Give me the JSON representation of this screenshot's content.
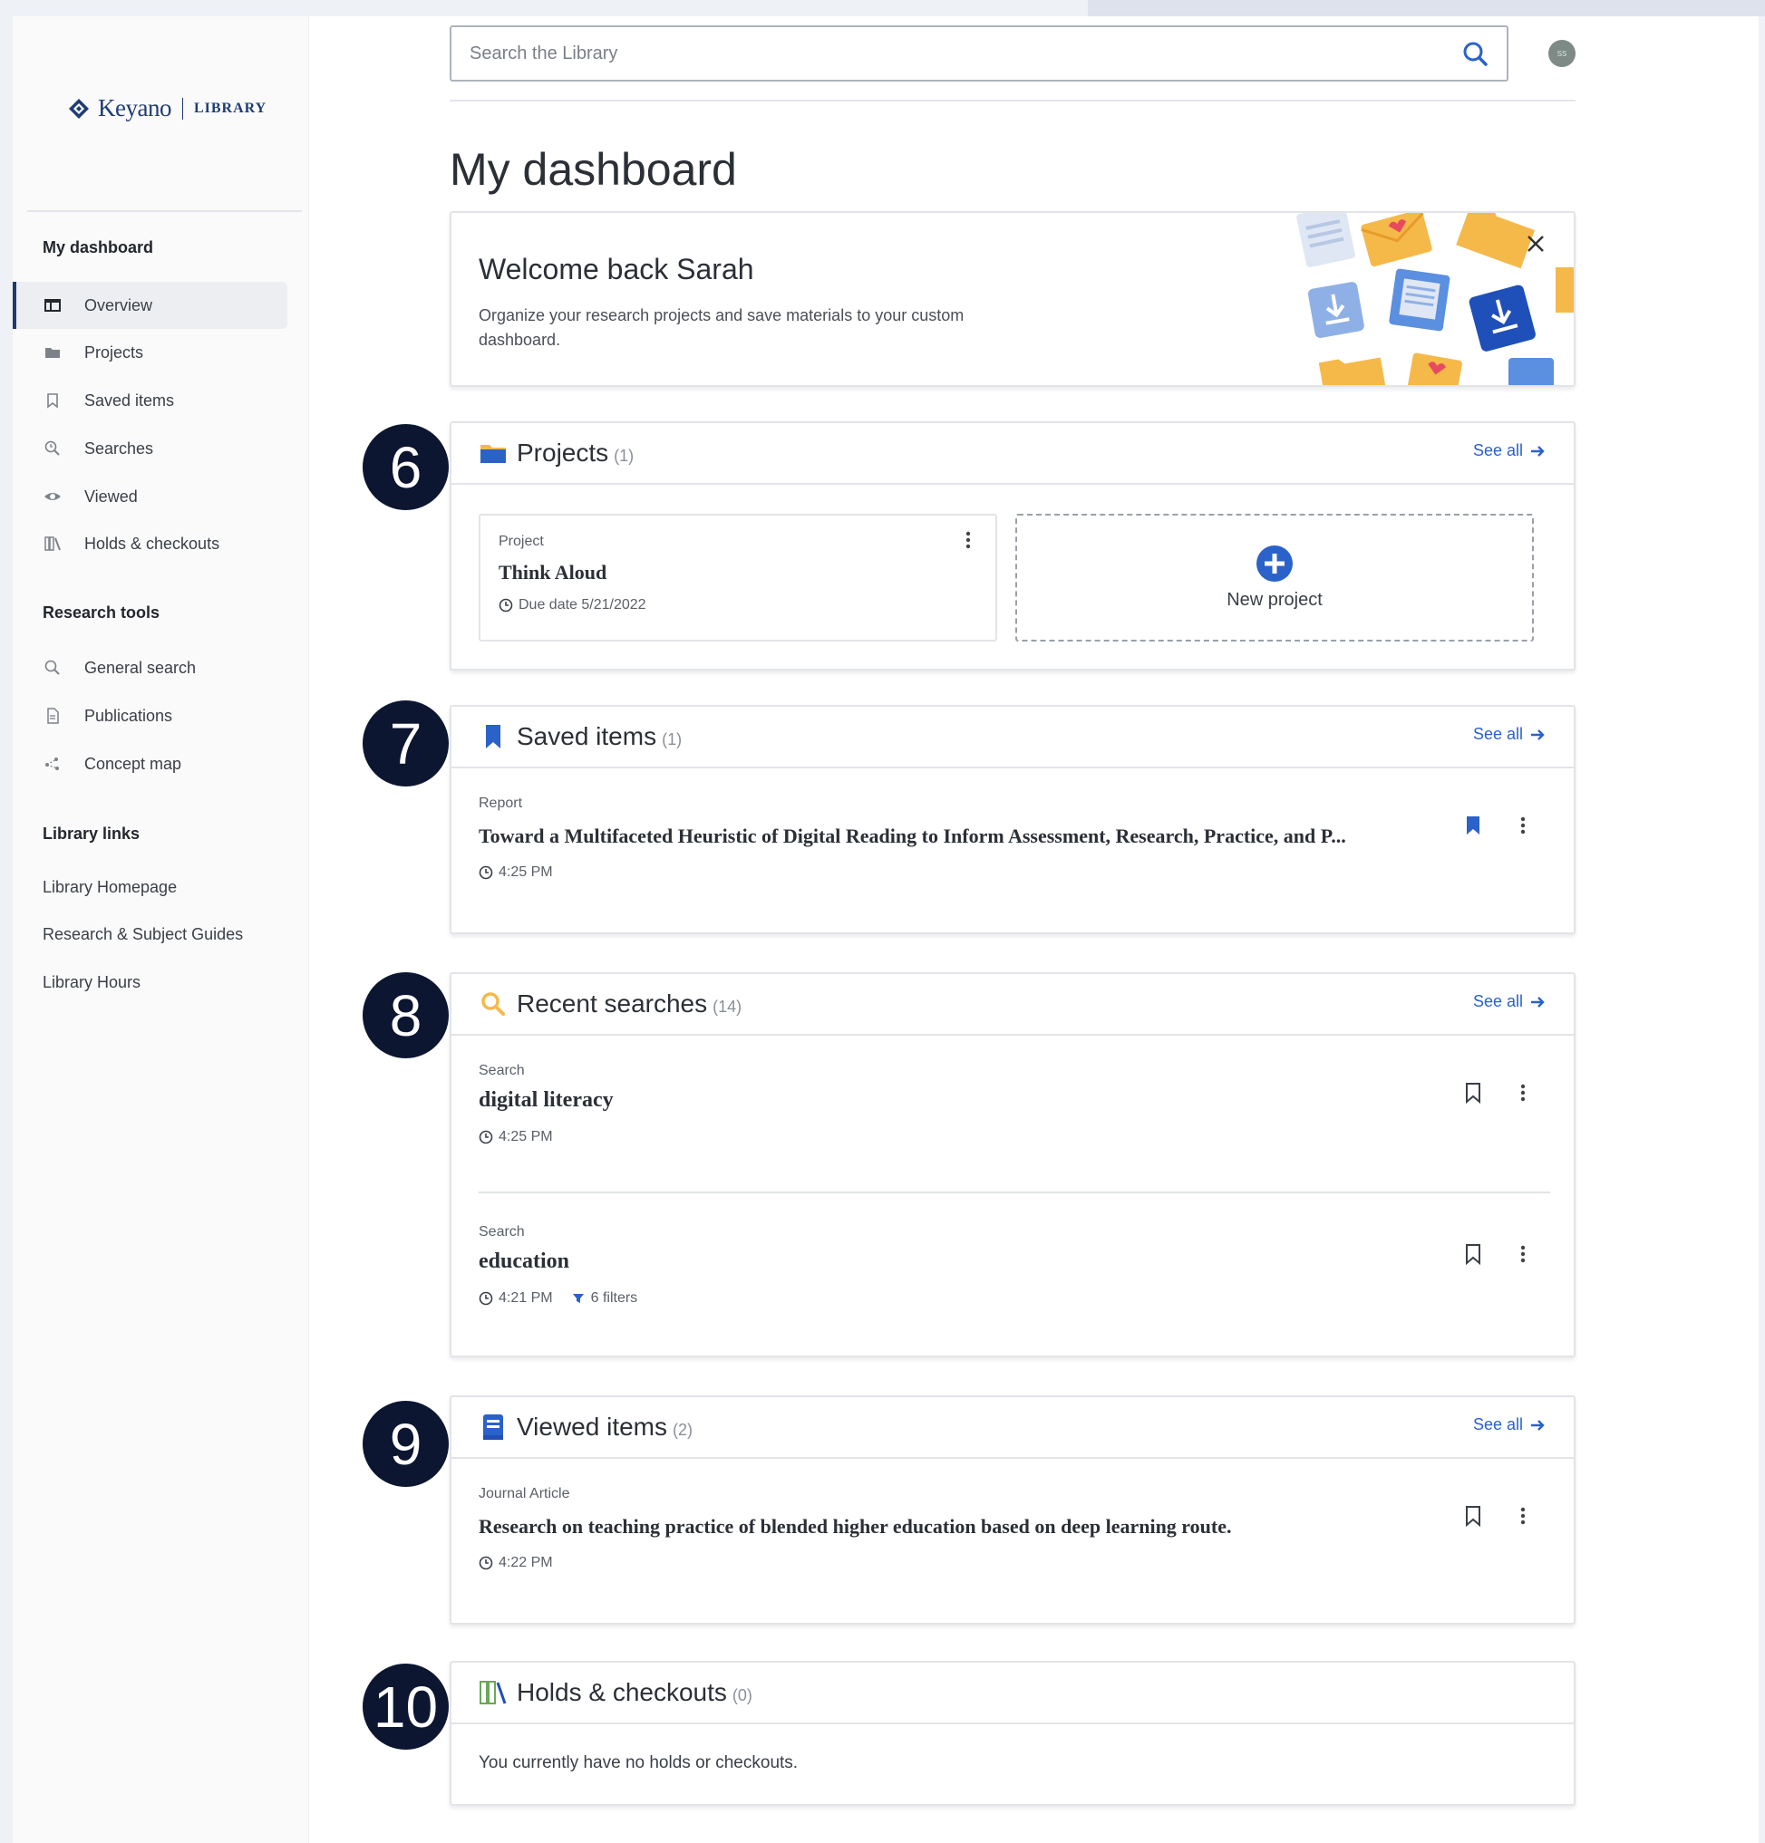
{
  "sidebar": {
    "logo_name": "Keyano",
    "logo_library": "LIBRARY",
    "dashboard_heading": "My dashboard",
    "nav": [
      {
        "label": "Overview",
        "icon": "overview-icon"
      },
      {
        "label": "Projects",
        "icon": "folder-icon"
      },
      {
        "label": "Saved items",
        "icon": "bookmark-icon"
      },
      {
        "label": "Searches",
        "icon": "search-history-icon"
      },
      {
        "label": "Viewed",
        "icon": "eye-icon"
      },
      {
        "label": "Holds & checkouts",
        "icon": "books-icon"
      }
    ],
    "tools_heading": "Research tools",
    "tools": [
      {
        "label": "General search",
        "icon": "search-icon"
      },
      {
        "label": "Publications",
        "icon": "document-icon"
      },
      {
        "label": "Concept map",
        "icon": "concept-map-icon"
      }
    ],
    "links_heading": "Library links",
    "links": [
      "Library Homepage",
      "Research & Subject Guides",
      "Library Hours"
    ]
  },
  "search": {
    "placeholder": "Search the Library"
  },
  "avatar_initials": "SS",
  "page_title": "My dashboard",
  "welcome": {
    "title": "Welcome back Sarah",
    "text": "Organize your research projects and save materials to your custom dashboard."
  },
  "badges": [
    "6",
    "7",
    "8",
    "9",
    "10"
  ],
  "projects": {
    "title": "Projects",
    "count": "(1)",
    "see_all": "See all",
    "items": [
      {
        "type": "Project",
        "title": "Think Aloud",
        "due": "Due date 5/21/2022"
      }
    ],
    "new_label": "New project"
  },
  "saved": {
    "title": "Saved items",
    "count": "(1)",
    "see_all": "See all",
    "items": [
      {
        "type": "Report",
        "title": "Toward a Multifaceted Heuristic of Digital Reading to Inform Assessment, Research, Practice, and P...",
        "time": "4:25 PM"
      }
    ]
  },
  "searches": {
    "title": "Recent searches",
    "count": "(14)",
    "see_all": "See all",
    "items": [
      {
        "type": "Search",
        "title": "digital literacy",
        "time": "4:25 PM"
      },
      {
        "type": "Search",
        "title": "education",
        "time": "4:21 PM",
        "filters": "6 filters"
      }
    ]
  },
  "viewed": {
    "title": "Viewed items",
    "count": "(2)",
    "see_all": "See all",
    "items": [
      {
        "type": "Journal Article",
        "title": "Research on teaching practice of blended higher education based on deep learning route.",
        "time": "4:22 PM"
      }
    ]
  },
  "holds": {
    "title": "Holds & checkouts",
    "count": "(0)",
    "empty": "You currently have no holds or checkouts."
  },
  "colors": {
    "accent": "#2a62c9",
    "navy": "#0c1630",
    "folder": "#f5b94a"
  }
}
